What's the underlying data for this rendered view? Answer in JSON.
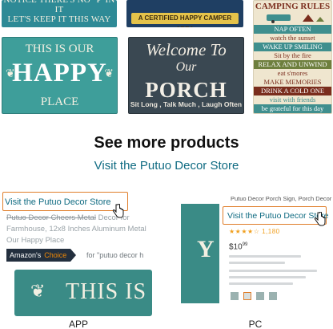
{
  "top_signs": {
    "notice_line1": "NOTICE THERE'S NO \"P\"IN IT",
    "notice_line2": "LET'S KEEP IT THIS WAY",
    "camper_banner": "A CERTIFIED HAPPY CAMPER AREA",
    "camping_title": "CAMPING RULES",
    "camping_rules": [
      {
        "text": "NAP OFTEN",
        "bg": "#3f8f8e",
        "color": "#ffffff"
      },
      {
        "text": "watch the sunset",
        "bg": "#efe6cf",
        "color": "#7a2d1d"
      },
      {
        "text": "WAKE UP SMILING",
        "bg": "#3f8f8e",
        "color": "#ffffff"
      },
      {
        "text": "Sit by the fire",
        "bg": "#efe6cf",
        "color": "#7a2d1d"
      },
      {
        "text": "RELAX AND UNWIND",
        "bg": "#6e7f3e",
        "color": "#ffffff"
      },
      {
        "text": "eat s'mores",
        "bg": "#efe6cf",
        "color": "#7a2d1d"
      },
      {
        "text": "MAKE MEMORIES",
        "bg": "#efe6cf",
        "color": "#7a2d1d"
      },
      {
        "text": "DRINK A COLD ONE",
        "bg": "#7a2d1d",
        "color": "#ffffff"
      },
      {
        "text": "visit with friends",
        "bg": "#efe6cf",
        "color": "#3f8f8e"
      },
      {
        "text": "be grateful for this day",
        "bg": "#3f8f8e",
        "color": "#ffffff"
      }
    ],
    "happy_line1": "THIS IS OUR",
    "happy_line2": "HAPPY",
    "happy_line3": "PLACE",
    "porch_line1": "Welcome To",
    "porch_line1b": "Our",
    "porch_line2": "PORCH",
    "porch_line3": "Sit Long , Talk Much , Laugh Often"
  },
  "heading": "See more products",
  "store_link": "Visit the Putuo Decor Store",
  "app": {
    "store_link": "Visit the Putuo Decor Store",
    "title_strike": "Putuo Decor Cheers Metal",
    "title_rest": "Decor for Farmhouse, 12x8 Inches Aluminum Metal Our Happy Place",
    "badge_a": "Amazon's",
    "badge_b": "Choice",
    "badge_for": "for \"putuo decor h",
    "image_text": "THIS IS O",
    "label": "APP"
  },
  "pc": {
    "top_title": "Putuo Decor Porch Sign, Porch Decor",
    "store_link": "Visit the Putuo Decor Store",
    "stars": "★★★★☆ 1,180",
    "price": "$10",
    "price_cents": "99",
    "thumb_text": "Y",
    "label": "PC"
  },
  "colors": {
    "link": "#0f6b82",
    "highlight_box": "#e07e2b",
    "badge_bg": "#232f3e",
    "badge_choice": "#f08804"
  }
}
